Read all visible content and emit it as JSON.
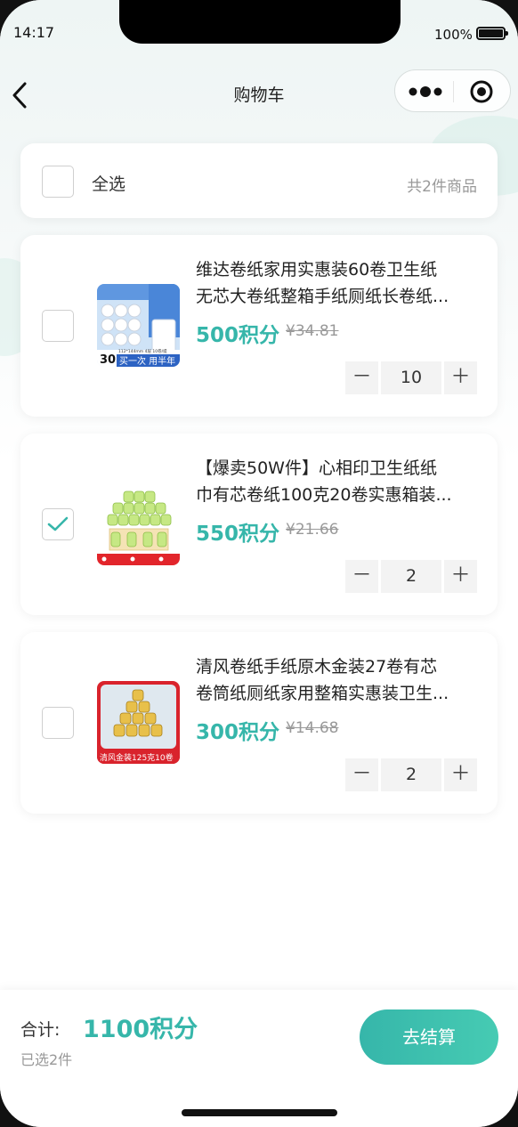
{
  "status_bar": {
    "time": "14:17",
    "battery": "100%"
  },
  "nav": {
    "title": "购物车"
  },
  "select_all": {
    "label": "全选",
    "count_text": "共2件商品"
  },
  "items": [
    {
      "title_line1": "维达卷纸家用实惠装60卷卫生纸",
      "title_line2": "无芯大卷纸整箱手纸厕纸长卷纸...",
      "points": "500积分",
      "price": "¥34.81",
      "quantity": "10",
      "checked": false,
      "image_text": {
        "badge": "30",
        "banner": "买一次 用半年",
        "spec": "112*144mm 4层 10卷/提"
      }
    },
    {
      "title_line1": "【爆卖50W件】心相印卫生纸纸",
      "title_line2": "巾有芯卷纸100克20卷实惠箱装...",
      "points": "550积分",
      "price": "¥21.66",
      "quantity": "2",
      "checked": true,
      "image_text": {}
    },
    {
      "title_line1": "清风卷纸手纸原木金装27卷有芯",
      "title_line2": "卷筒纸厕纸家用整箱实惠装卫生...",
      "points": "300积分",
      "price": "¥14.68",
      "quantity": "2",
      "checked": false,
      "image_text": {
        "banner": "清风金装125克10卷"
      }
    }
  ],
  "stepper": {
    "minus": "－",
    "plus": "＋"
  },
  "footer": {
    "total_label": "合计:",
    "total_value": "1100积分",
    "selected_text": "已选2件",
    "checkout_label": "去结算"
  },
  "colors": {
    "accent": "#36b6aa",
    "accent_light": "#46cbb3"
  }
}
